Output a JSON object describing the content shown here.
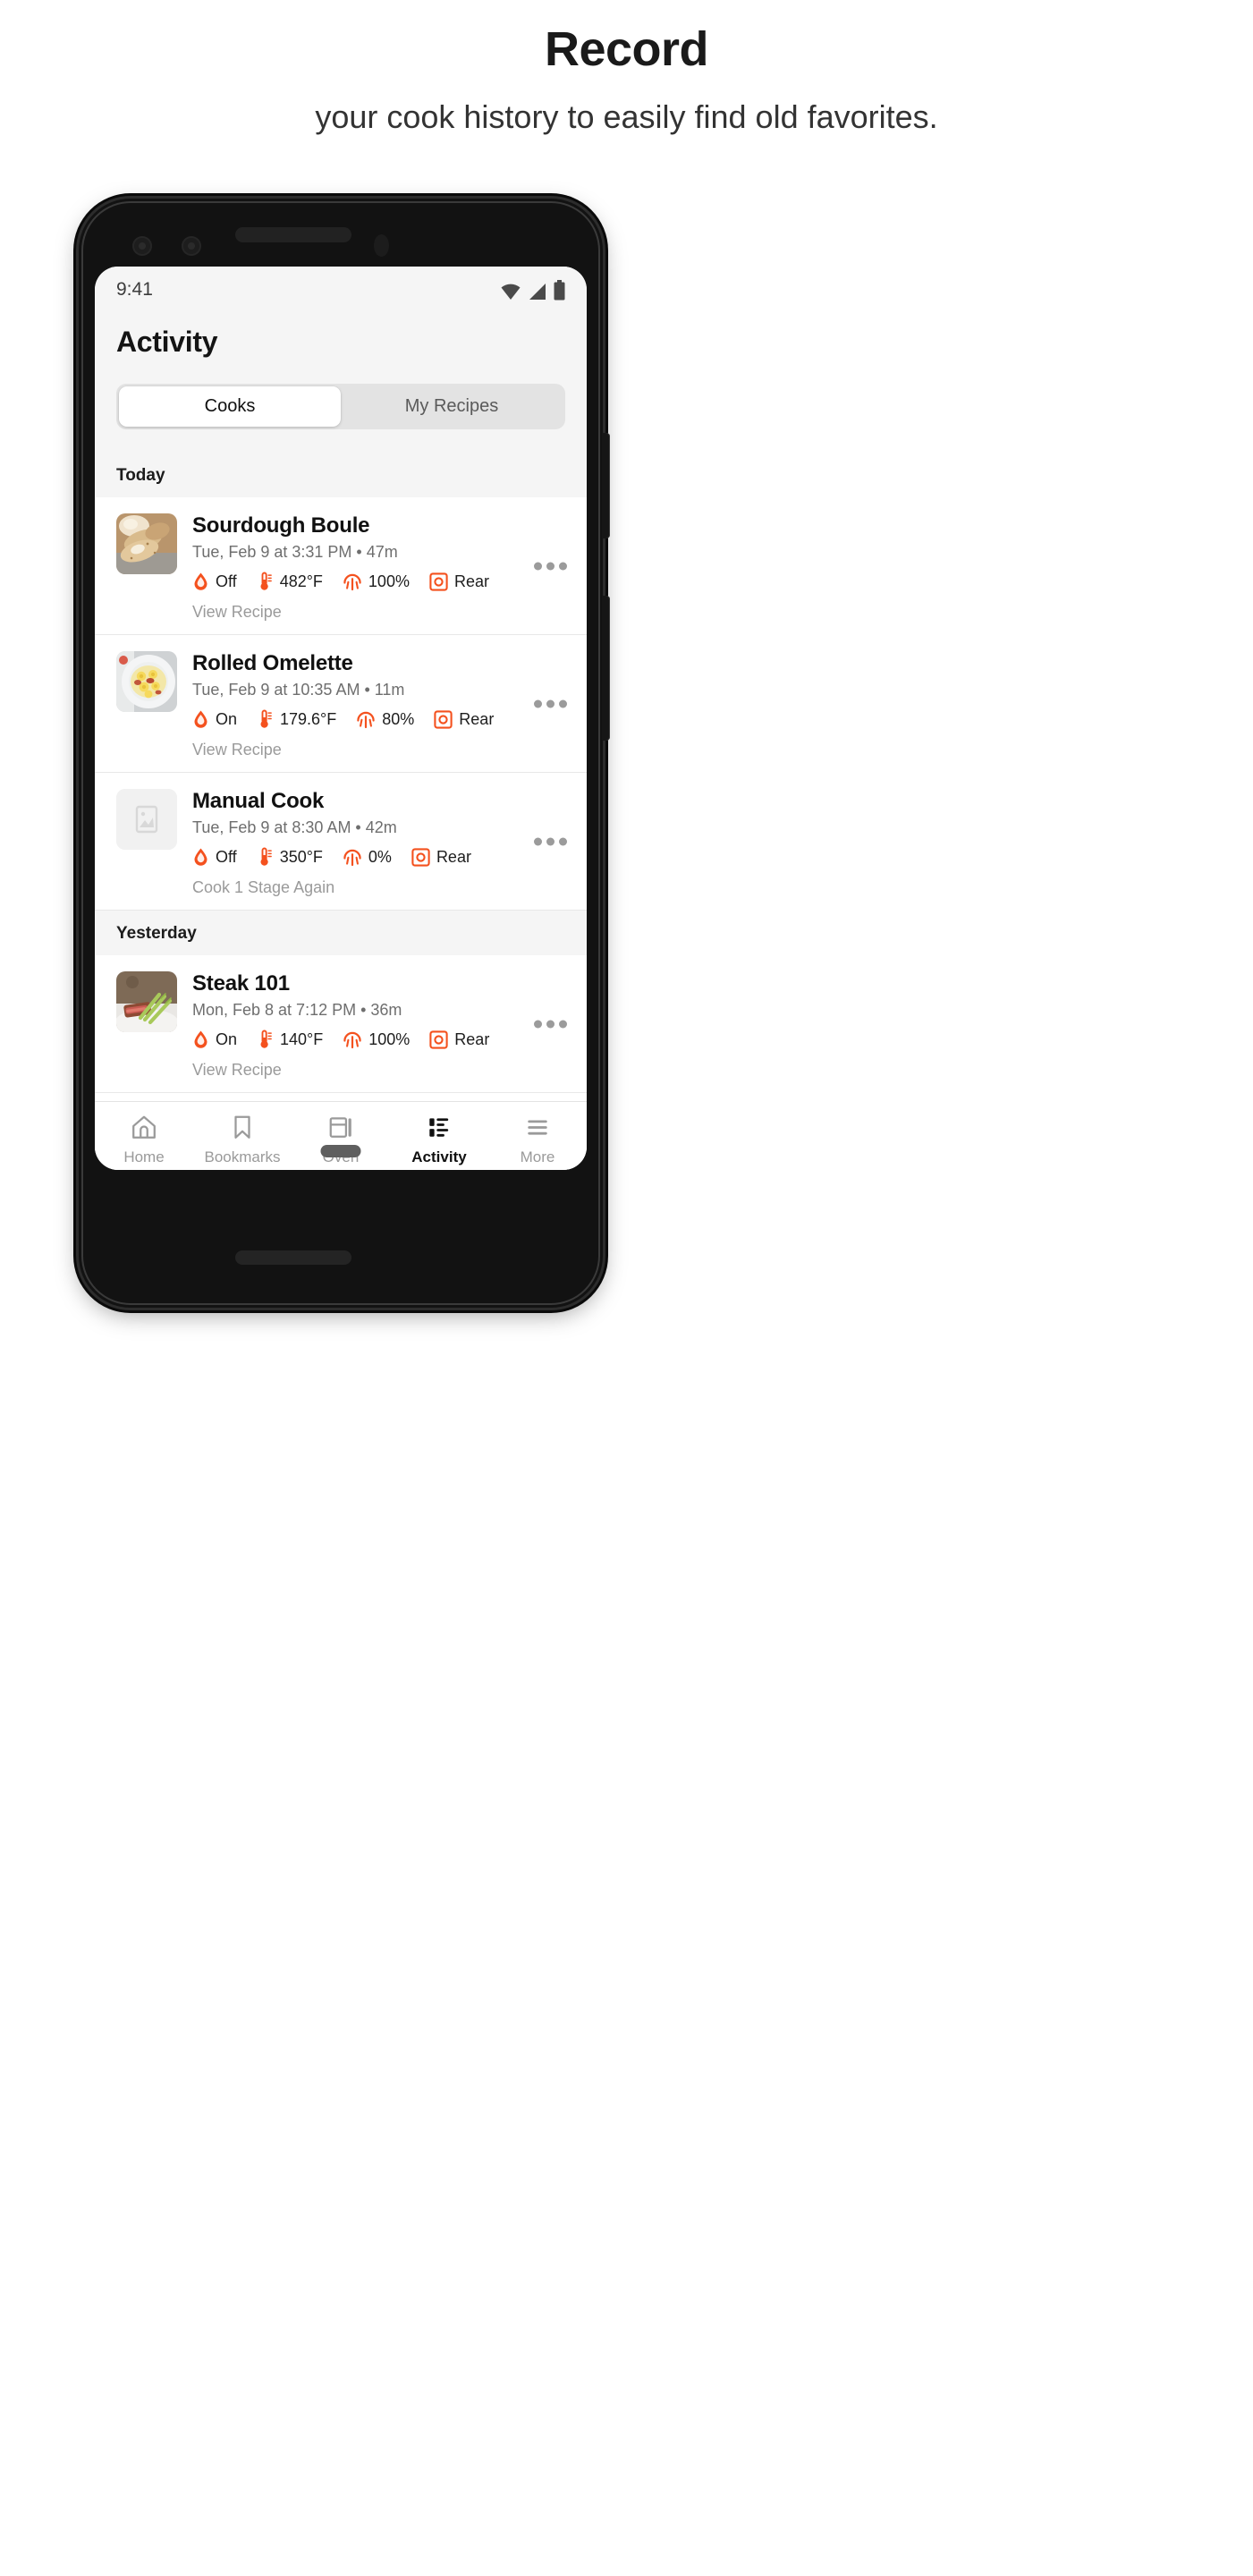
{
  "promo": {
    "title": "Record",
    "subtitle": "your cook history to easily find old favorites."
  },
  "theme": {
    "accent": "#F4511E",
    "accent_alt": "#FF5722",
    "header_bg": "#F5F5F5",
    "screen_bg": "#FFFFFF",
    "muted_text": "#6E6E6E",
    "link_text": "#9A9A9A"
  },
  "statusbar": {
    "time": "9:41",
    "icons": [
      "wifi-icon",
      "cell-signal-icon",
      "battery-icon"
    ]
  },
  "header": {
    "title": "Activity"
  },
  "segmented": {
    "options": [
      {
        "label": "Cooks",
        "active": true
      },
      {
        "label": "My Recipes",
        "active": false
      }
    ]
  },
  "groups": [
    {
      "label": "Today",
      "items": [
        {
          "title": "Sourdough Boule",
          "subtitle": "Tue, Feb 9 at 3:31 PM • 47m",
          "thumb": "sourdough-bread-photo",
          "metrics": [
            {
              "icon": "steam-droplet-icon",
              "value": "Off"
            },
            {
              "icon": "thermometer-icon",
              "value": "482°F"
            },
            {
              "icon": "convection-fan-icon",
              "value": "100%"
            },
            {
              "icon": "rear-element-icon",
              "value": "Rear"
            }
          ],
          "link": "View Recipe",
          "menu": "more-options"
        },
        {
          "title": "Rolled Omelette",
          "subtitle": "Tue, Feb 9 at 10:35 AM • 11m",
          "thumb": "omelette-plate-photo",
          "metrics": [
            {
              "icon": "steam-droplet-icon",
              "value": "On"
            },
            {
              "icon": "thermometer-icon",
              "value": "179.6°F"
            },
            {
              "icon": "convection-fan-icon",
              "value": "80%"
            },
            {
              "icon": "rear-element-icon",
              "value": "Rear"
            }
          ],
          "link": "View Recipe",
          "menu": "more-options"
        },
        {
          "title": "Manual Cook",
          "subtitle": "Tue, Feb 9 at 8:30 AM • 42m",
          "thumb": "image-placeholder",
          "metrics": [
            {
              "icon": "steam-droplet-icon",
              "value": "Off"
            },
            {
              "icon": "thermometer-icon",
              "value": "350°F"
            },
            {
              "icon": "convection-fan-icon",
              "value": "0%"
            },
            {
              "icon": "rear-element-icon",
              "value": "Rear"
            }
          ],
          "link": "Cook 1 Stage Again",
          "menu": "more-options"
        }
      ]
    },
    {
      "label": "Yesterday",
      "items": [
        {
          "title": "Steak 101",
          "subtitle": "Mon, Feb 8 at 7:12 PM • 36m",
          "thumb": "steak-asparagus-photo",
          "metrics": [
            {
              "icon": "steam-droplet-icon",
              "value": "On"
            },
            {
              "icon": "thermometer-icon",
              "value": "140°F"
            },
            {
              "icon": "convection-fan-icon",
              "value": "100%"
            },
            {
              "icon": "rear-element-icon",
              "value": "Rear"
            }
          ],
          "link": "View Recipe",
          "menu": "more-options"
        }
      ]
    }
  ],
  "tabbar": {
    "tabs": [
      {
        "label": "Home",
        "icon": "home-icon",
        "active": false
      },
      {
        "label": "Bookmarks",
        "icon": "bookmark-icon",
        "active": false
      },
      {
        "label": "Oven",
        "icon": "oven-icon",
        "active": false
      },
      {
        "label": "Activity",
        "icon": "activity-list-icon",
        "active": true
      },
      {
        "label": "More",
        "icon": "hamburger-menu-icon",
        "active": false
      }
    ]
  }
}
